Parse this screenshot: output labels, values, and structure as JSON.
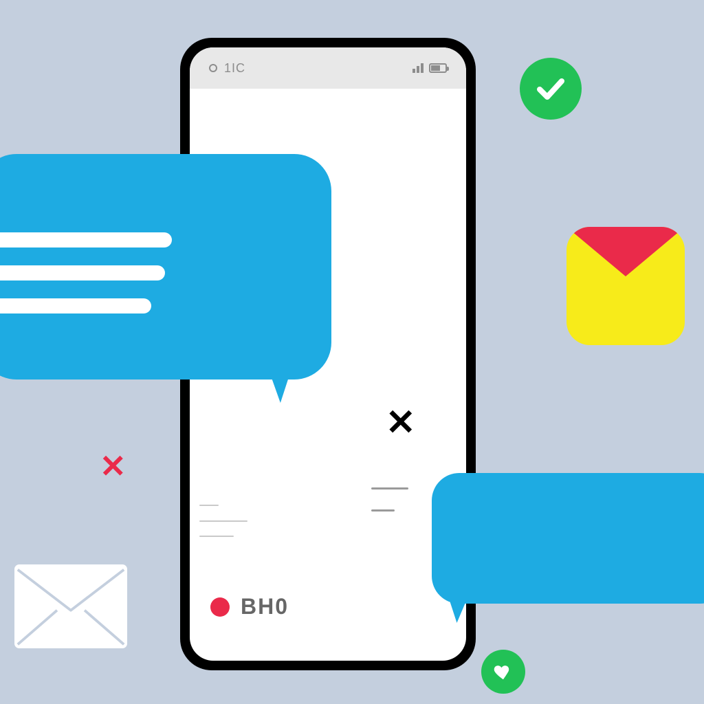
{
  "status_bar": {
    "time_label": "1IC"
  },
  "screen": {
    "close_glyph": "✕",
    "bottom_label": "BH0"
  },
  "icons": {
    "check": "check-icon",
    "mail": "mail-icon",
    "envelope": "envelope-icon",
    "heart": "heart-icon",
    "red_x": "✕",
    "big_x": "✕"
  },
  "colors": {
    "bubble_blue": "#1eabe2",
    "accent_green": "#22c156",
    "accent_red": "#ea2a4a",
    "mail_yellow": "#f7eb1a",
    "background": "#c4cfde"
  }
}
